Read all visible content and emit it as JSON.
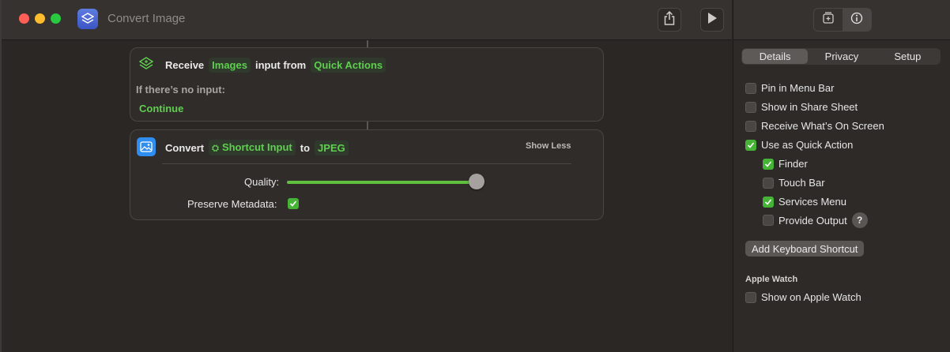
{
  "window": {
    "title": "Convert Image"
  },
  "icons": {
    "app": "shortcuts-icon",
    "share": "share-icon",
    "run": "play-icon",
    "library": "add-action-icon",
    "info": "info-icon",
    "receive": "shortcut-stack-icon",
    "convert": "image-icon"
  },
  "receive_card": {
    "receive_label": "Receive",
    "type_token": "Images",
    "input_from_label": "input from",
    "source_token": "Quick Actions",
    "no_input_label": "If there’s no input:",
    "no_input_action": "Continue"
  },
  "convert_card": {
    "convert_label": "Convert",
    "input_token": "Shortcut Input",
    "to_label": "to",
    "format_token": "JPEG",
    "show_less": "Show Less",
    "quality_label": "Quality:",
    "quality_value": 0.96,
    "preserve_label": "Preserve Metadata:",
    "preserve_checked": true
  },
  "sidebar": {
    "tabs": [
      "Details",
      "Privacy",
      "Setup"
    ],
    "active_tab": "Details",
    "options": [
      {
        "label": "Pin in Menu Bar",
        "checked": false
      },
      {
        "label": "Show in Share Sheet",
        "checked": false
      },
      {
        "label": "Receive What’s On Screen",
        "checked": false
      },
      {
        "label": "Use as Quick Action",
        "checked": true
      }
    ],
    "quick_action_options": [
      {
        "label": "Finder",
        "checked": true
      },
      {
        "label": "Touch Bar",
        "checked": false
      },
      {
        "label": "Services Menu",
        "checked": true
      },
      {
        "label": "Provide Output",
        "checked": false
      }
    ],
    "help_glyph": "?",
    "keyboard_shortcut_button": "Add Keyboard Shortcut",
    "apple_watch_heading": "Apple Watch",
    "apple_watch_option": {
      "label": "Show on Apple Watch",
      "checked": false
    }
  },
  "colors": {
    "accent_green": "#5fcf4f",
    "check_green": "#45b336",
    "app_icon_blue": "#4a66d6"
  }
}
